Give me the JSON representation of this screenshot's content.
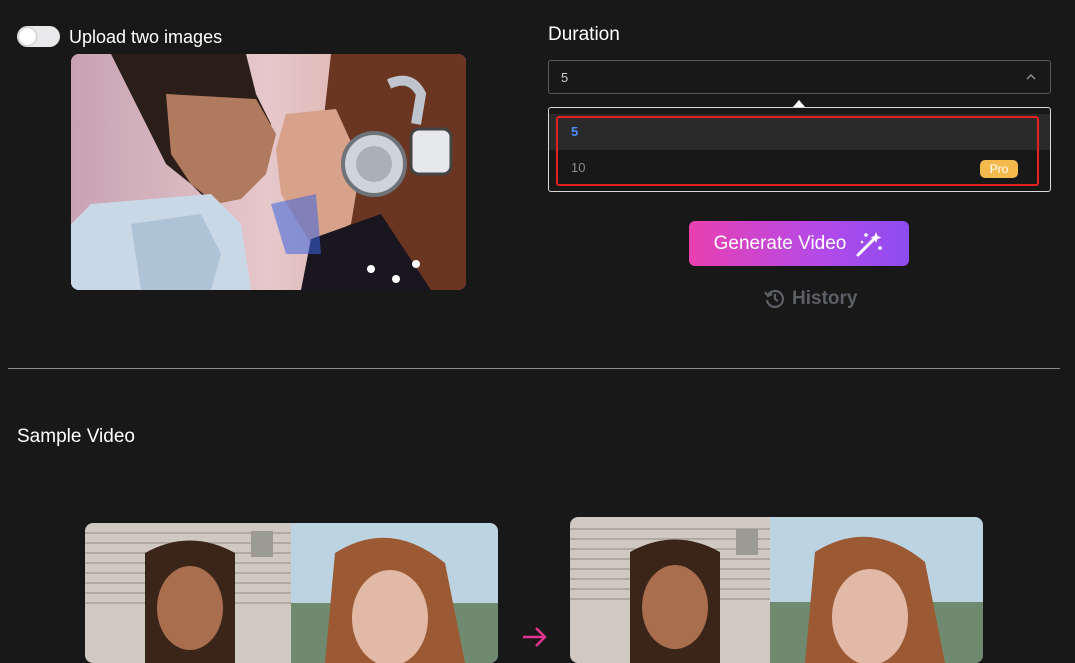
{
  "upload": {
    "toggle_label": "Upload two images",
    "toggle_on": false
  },
  "duration": {
    "label": "Duration",
    "selected_value": "5",
    "options": [
      {
        "label": "5",
        "selected": true,
        "badge": ""
      },
      {
        "label": "10",
        "selected": false,
        "badge": "Pro"
      }
    ]
  },
  "actions": {
    "generate_label": "Generate Video",
    "history_label": "History"
  },
  "sample": {
    "title": "Sample Video"
  },
  "colors": {
    "background": "#181818",
    "accent_gradient_start": "#e940b0",
    "accent_gradient_end": "#8d4cf0",
    "selected_option": "#4f8cf7",
    "pro_badge": "#f3b94c",
    "highlight": "#e5221f",
    "arrow": "#e0358e"
  },
  "icons": {
    "toggle": "toggle-switch",
    "chevron": "chevron-up-icon",
    "magic": "magic-wand-icon",
    "history": "history-clock-icon",
    "arrow": "arrow-right-icon"
  }
}
